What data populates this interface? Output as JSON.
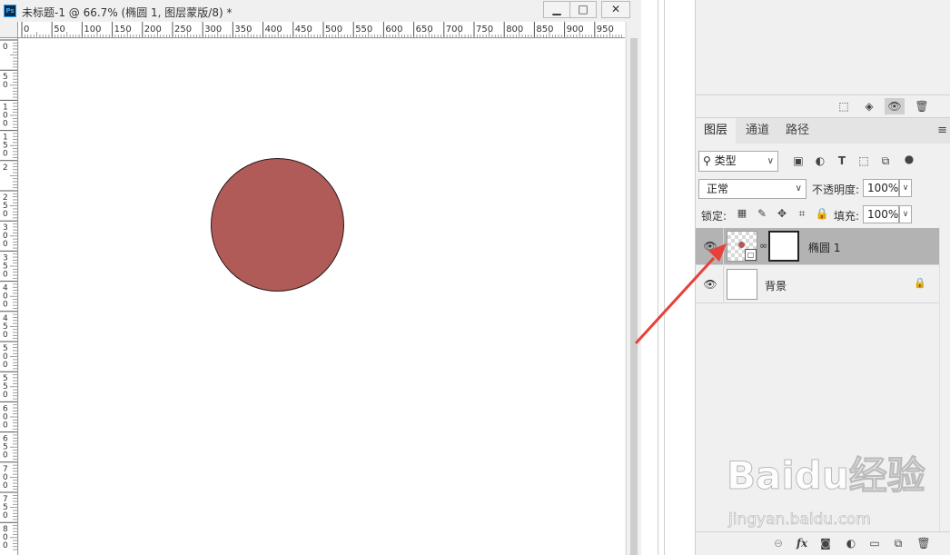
{
  "document": {
    "app_logo_text": "Ps",
    "title": "未标题-1 @ 66.7% (椭圆 1, 图层蒙版/8) *",
    "window_buttons": {
      "minimize": "▁",
      "maximize": "□",
      "close": "✕"
    },
    "ruler_top_labels": [
      "0",
      "50",
      "100",
      "150",
      "200",
      "250",
      "300",
      "350",
      "400",
      "450",
      "500",
      "550",
      "600",
      "650",
      "700",
      "750",
      "800",
      "850",
      "900",
      "950"
    ],
    "ruler_left_labels": [
      "0",
      "5\n0",
      "1\n0\n0",
      "1\n5\n0",
      "2",
      "2\n5\n0",
      "3\n0\n0",
      "3\n5\n0",
      "4\n0\n0",
      "4\n5\n0",
      "5\n0\n0",
      "5\n5\n0",
      "6\n0\n0",
      "6\n5\n0",
      "7\n0\n0",
      "7\n5\n0",
      "8\n0\n0"
    ],
    "shape_color": "#b05b58"
  },
  "layers_panel": {
    "tabs": [
      "图层",
      "通道",
      "路径"
    ],
    "active_tab": "图层",
    "filter_label": "类型",
    "blend_mode": "正常",
    "opacity_label": "不透明度:",
    "opacity_value": "100%",
    "lock_label": "锁定:",
    "fill_label": "填充:",
    "fill_value": "100%",
    "layers": [
      {
        "name": "椭圆 1",
        "selected": true,
        "has_mask": true
      },
      {
        "name": "背景",
        "selected": false,
        "locked": true
      }
    ]
  },
  "watermark": {
    "main": "Baidu经验",
    "sub": "jingyan.baidu.com"
  },
  "annotation": {
    "arrow_color": "#e8403a"
  }
}
